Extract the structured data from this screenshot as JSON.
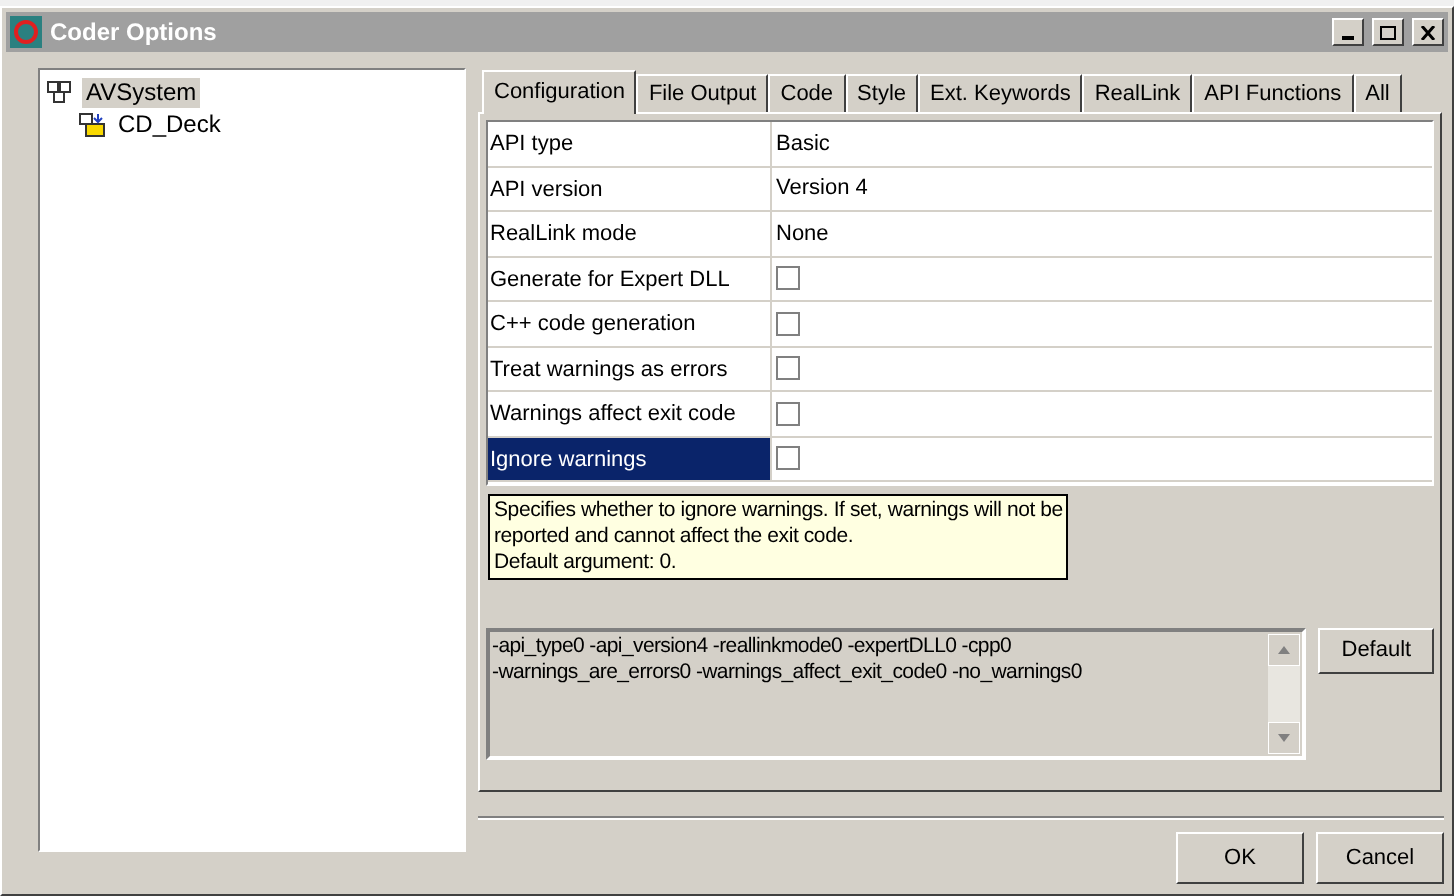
{
  "window": {
    "title": "Coder Options"
  },
  "tree": [
    {
      "label": "AVSystem",
      "selected": true,
      "children": [
        {
          "label": "CD_Deck",
          "selected": false
        }
      ]
    }
  ],
  "tabs": [
    {
      "label": "Configuration",
      "selected": true
    },
    {
      "label": "File Output",
      "selected": false
    },
    {
      "label": "Code",
      "selected": false
    },
    {
      "label": "Style",
      "selected": false
    },
    {
      "label": "Ext. Keywords",
      "selected": false
    },
    {
      "label": "RealLink",
      "selected": false
    },
    {
      "label": "API Functions",
      "selected": false
    },
    {
      "label": "All",
      "selected": false
    }
  ],
  "properties": [
    {
      "name": "API type",
      "kind": "text",
      "value": "Basic",
      "selected": false
    },
    {
      "name": "API version",
      "kind": "text",
      "value": "Version 4",
      "selected": false
    },
    {
      "name": "RealLink mode",
      "kind": "text",
      "value": "None",
      "selected": false
    },
    {
      "name": "Generate for Expert DLL",
      "kind": "checkbox",
      "checked": false,
      "selected": false
    },
    {
      "name": "C++ code generation",
      "kind": "checkbox",
      "checked": false,
      "selected": false
    },
    {
      "name": "Treat warnings as errors",
      "kind": "checkbox",
      "checked": false,
      "selected": false
    },
    {
      "name": "Warnings affect exit code",
      "kind": "checkbox",
      "checked": false,
      "selected": false
    },
    {
      "name": "Ignore warnings",
      "kind": "checkbox",
      "checked": false,
      "selected": true
    }
  ],
  "tooltip": [
    "Specifies whether to ignore warnings. If set, warnings will not be",
    "reported and cannot affect the exit code.",
    "Default argument: 0."
  ],
  "command_line": [
    "-api_type0 -api_version4 -reallinkmode0 -expertDLL0 -cpp0",
    "-warnings_are_errors0 -warnings_affect_exit_code0 -no_warnings0"
  ],
  "default_button": "Default",
  "buttons": [
    "OK",
    "Cancel"
  ]
}
